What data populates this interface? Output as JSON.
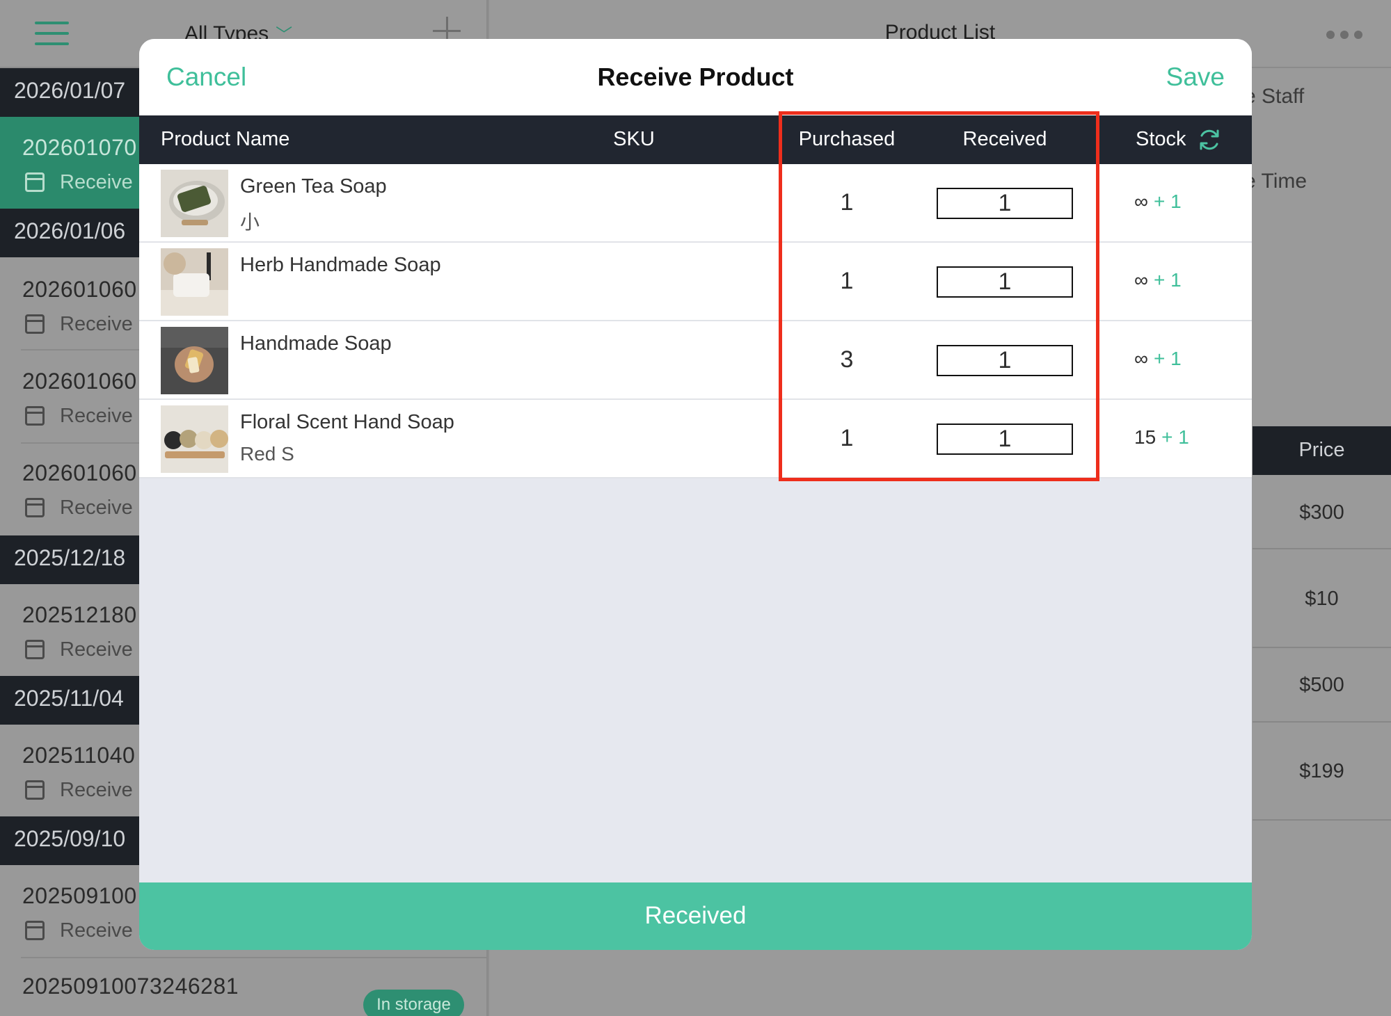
{
  "background": {
    "types_filter": "All Types",
    "list_title": "Product List",
    "groups": [
      {
        "date": "2026/01/07",
        "orders": [
          {
            "number": "202601070",
            "status": "Receive"
          }
        ]
      },
      {
        "date": "2026/01/06",
        "orders": [
          {
            "number": "202601060",
            "status": "Receive"
          },
          {
            "number": "202601060",
            "status": "Receive"
          },
          {
            "number": "202601060",
            "status": "Receive"
          }
        ]
      },
      {
        "date": "2025/12/18",
        "orders": [
          {
            "number": "202512180",
            "status": "Receive"
          }
        ]
      },
      {
        "date": "2025/11/04",
        "orders": [
          {
            "number": "202511040",
            "status": "Receive"
          }
        ]
      },
      {
        "date": "2025/09/10",
        "orders": [
          {
            "number": "202509100",
            "status": "Receive"
          },
          {
            "number": "20250910073246281",
            "status": ""
          }
        ]
      }
    ],
    "storage_badge": "In storage",
    "right_labels": [
      "e Staff",
      "e Time"
    ],
    "price_header": "Price",
    "prices": [
      "$300",
      "$10",
      "$500",
      "$199"
    ]
  },
  "modal": {
    "cancel_label": "Cancel",
    "title": "Receive Product",
    "save_label": "Save",
    "columns": {
      "name": "Product Name",
      "sku": "SKU",
      "purchased": "Purchased",
      "received": "Received",
      "stock": "Stock"
    },
    "rows": [
      {
        "name": "Green Tea Soap",
        "variant": "小",
        "sku": "",
        "purchased": "1",
        "received": "1",
        "stock": "∞",
        "stock_add": "+ 1"
      },
      {
        "name": "Herb Handmade Soap",
        "variant": "",
        "sku": "",
        "purchased": "1",
        "received": "1",
        "stock": "∞",
        "stock_add": "+ 1"
      },
      {
        "name": "Handmade Soap",
        "variant": "",
        "sku": "",
        "purchased": "3",
        "received": "1",
        "stock": "∞",
        "stock_add": "+ 1"
      },
      {
        "name": "Floral Scent Hand Soap",
        "variant": "Red S",
        "sku": "",
        "purchased": "1",
        "received": "1",
        "stock": "15",
        "stock_add": "+ 1"
      }
    ],
    "received_button": "Received"
  },
  "colors": {
    "accent": "#4cc3a2",
    "header_dark": "#212630",
    "highlight": "#ee2e1c"
  }
}
